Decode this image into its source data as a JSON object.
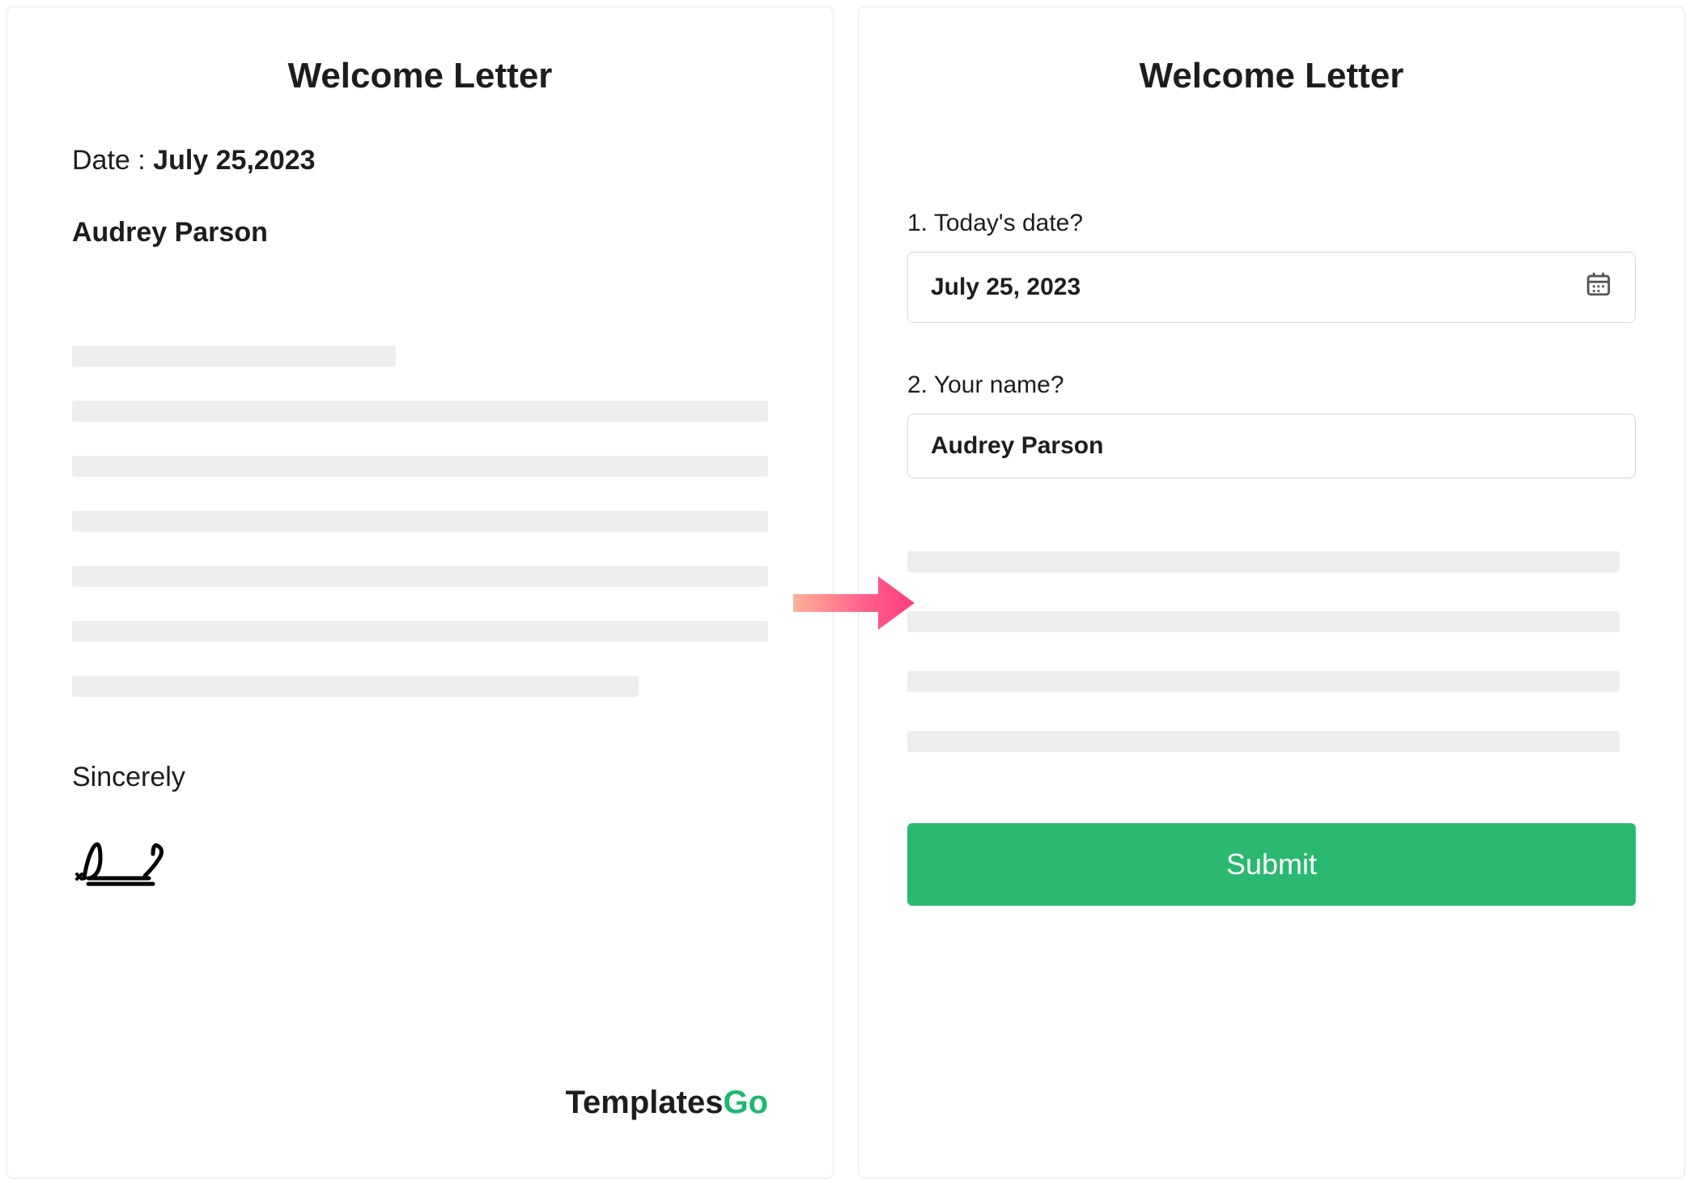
{
  "left": {
    "title": "Welcome Letter",
    "date_label": "Date : ",
    "date_value": "July 25,2023",
    "name": "Audrey Parson",
    "closing": "Sincerely",
    "brand_part1": "Templates",
    "brand_part2": "Go"
  },
  "right": {
    "title": "Welcome Letter",
    "q1_number": "1.",
    "q1_label": "Today's date?",
    "q1_value": "July 25, 2023",
    "q2_number": "2.",
    "q2_label": "Your name?",
    "q2_value": "Audrey Parson",
    "submit_label": "Submit"
  }
}
